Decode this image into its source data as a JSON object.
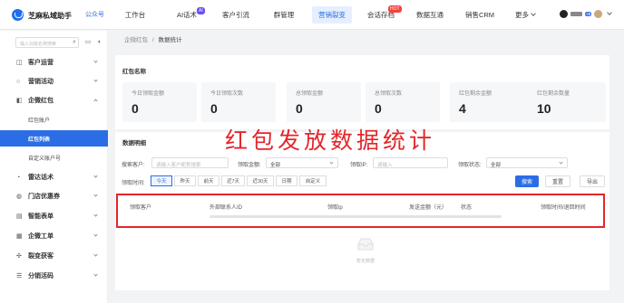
{
  "header": {
    "brand": "芝麻私域助手",
    "brand_caret": "∨",
    "channel": "公众号",
    "nav": [
      {
        "label": "工作台"
      },
      {
        "label": "AI话术",
        "badge": "AI"
      },
      {
        "label": "客户引流"
      },
      {
        "label": "群管理"
      },
      {
        "label": "营销裂变",
        "active": true
      },
      {
        "label": "会话存档",
        "badge": "HOT"
      },
      {
        "label": "数据互通"
      },
      {
        "label": "销售CRM"
      },
      {
        "label": "更多"
      }
    ],
    "right_badge": "+8",
    "accent": "#2b6de5"
  },
  "sidebar": {
    "search_placeholder": "输入功能名称搜索",
    "items": [
      {
        "icon": "customer-icon",
        "label": "客户运营"
      },
      {
        "icon": "marketing-icon",
        "label": "营销活动"
      },
      {
        "icon": "redpacket-icon",
        "label": "企微红包",
        "expanded": true
      },
      {
        "label": "红包账户",
        "sub": true
      },
      {
        "label": "红包列表",
        "sub": true,
        "selected": true
      },
      {
        "label": "自定义账户号",
        "sub": true
      },
      {
        "icon": "script-icon",
        "label": "雷达话术"
      },
      {
        "icon": "coupon-icon",
        "label": "门店优惠券"
      },
      {
        "icon": "form-icon",
        "label": "智能表单"
      },
      {
        "icon": "ticket-icon",
        "label": "企微工单"
      },
      {
        "icon": "fission-icon",
        "label": "裂变获客"
      },
      {
        "icon": "distribution-icon",
        "label": "分销活码"
      }
    ]
  },
  "breadcrumb": {
    "parent": "企微红包",
    "sep": "/",
    "current": "数据统计"
  },
  "summary": {
    "title": "红包名称",
    "stats": [
      {
        "label": "今日领取金额",
        "value": "0"
      },
      {
        "label": "今日领取次数",
        "value": "0"
      },
      {
        "label": "总领取金额",
        "value": "0"
      },
      {
        "label": "总领取次数",
        "value": "0"
      },
      {
        "label": "红包剩余金额",
        "value": "4"
      },
      {
        "label": "红包剩余数量",
        "value": "10"
      }
    ]
  },
  "overlay_text": "红包发放数据统计",
  "detail": {
    "title": "数据明细",
    "filters": {
      "customer_label": "搜索客户:",
      "customer_placeholder": "请输入客户昵称搜索",
      "amount_label": "领取金额:",
      "amount_value": "全部",
      "ip_label": "领取IP:",
      "ip_placeholder": "请输入",
      "status_label": "领取状态:",
      "status_value": "全部",
      "time_label": "领取时间:",
      "time_options": [
        "今天",
        "昨天",
        "前天",
        "近7天",
        "近30天",
        "日期",
        "自定义"
      ],
      "time_selected": "今天"
    },
    "buttons": {
      "search": "搜索",
      "reset": "重置",
      "export": "导出"
    },
    "table_headers": [
      "领取客户",
      "外部联系人ID",
      "领取ip",
      "发送金额（元）",
      "状态",
      "领取时间/退回时间"
    ],
    "empty_text": "暂无数据"
  }
}
